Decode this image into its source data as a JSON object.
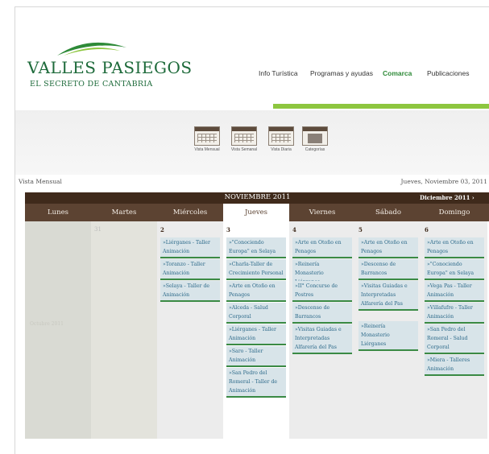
{
  "brand": {
    "title": "Valles Pasiegos",
    "subtitle": "El secreto de Cantabria"
  },
  "nav": {
    "items": [
      {
        "label": "Info Turística"
      },
      {
        "label": "Programas y ayudas"
      },
      {
        "label": "Comarca"
      },
      {
        "label": "Publicaciones"
      }
    ],
    "active_index": 2
  },
  "views": [
    {
      "label": "Vista Mensual",
      "icon": "calendar-month-icon"
    },
    {
      "label": "Vista Semanal",
      "icon": "calendar-week-icon"
    },
    {
      "label": "Vista Diaria",
      "icon": "calendar-day-icon"
    },
    {
      "label": "Categorías",
      "icon": "folder-icon"
    }
  ],
  "vista_label": "Vista Mensual",
  "current_date": "Jueves, Noviembre 03, 2011",
  "calendar": {
    "month": "NOVIEMBRE 2011",
    "next": "Diciembre 2011 ›",
    "days": [
      "Lunes",
      "Martes",
      "Miércoles",
      "Jueves",
      "Viernes",
      "Sábado",
      "Domingo"
    ],
    "prev_day_number": "31",
    "prev_month_ghost": "Octubre 2011",
    "columns": [
      {
        "number": "2",
        "events": [
          "»Liérganes - Taller Animación",
          "»Toranzo - Taller Animación",
          "»Selaya - Taller de Animación"
        ]
      },
      {
        "number": "3",
        "events": [
          "»\"Conociendo Europa\" en Selaya",
          "»Charla-Taller de Crecimiento Personal",
          "»Arte en Otoño en Penagos",
          "»Alceda - Salud Corporal",
          "»Liérganes - Taller Animación",
          "»Saro - Taller Animación",
          "»San Pedro del Romeral - Taller de Animación"
        ]
      },
      {
        "number": "4",
        "events": [
          "»Arte en Otoño en Penagos",
          "»Reinería Monasterio Liérganes",
          "»II° Concurso de Postres",
          "»Descenso de Barrancos",
          "»Visitas Guiadas e Interpretadas Alfarería del Pas"
        ]
      },
      {
        "number": "5",
        "events": [
          "»Arte en Otoño en Penagos",
          "»Descenso de Barrancos",
          "»Visitas Guiadas e Interpretadas Alfarería del Pas",
          "»Reinería Monasterio Liérganes"
        ]
      },
      {
        "number": "6",
        "events": [
          "»Arte en Otoño en Penagos",
          "»\"Conociendo Europa\" en Selaya",
          "»Vega Pas - Taller Animación",
          "»Villafufre - Taller Animación",
          "»San Pedro del Romeral - Salud Corporal",
          "»Miera - Talleres Animación"
        ]
      }
    ]
  },
  "colors": {
    "brand_green": "#1d6a3a",
    "accent_green": "#8dc63f",
    "calendar_brown": "#3f2a1b"
  }
}
